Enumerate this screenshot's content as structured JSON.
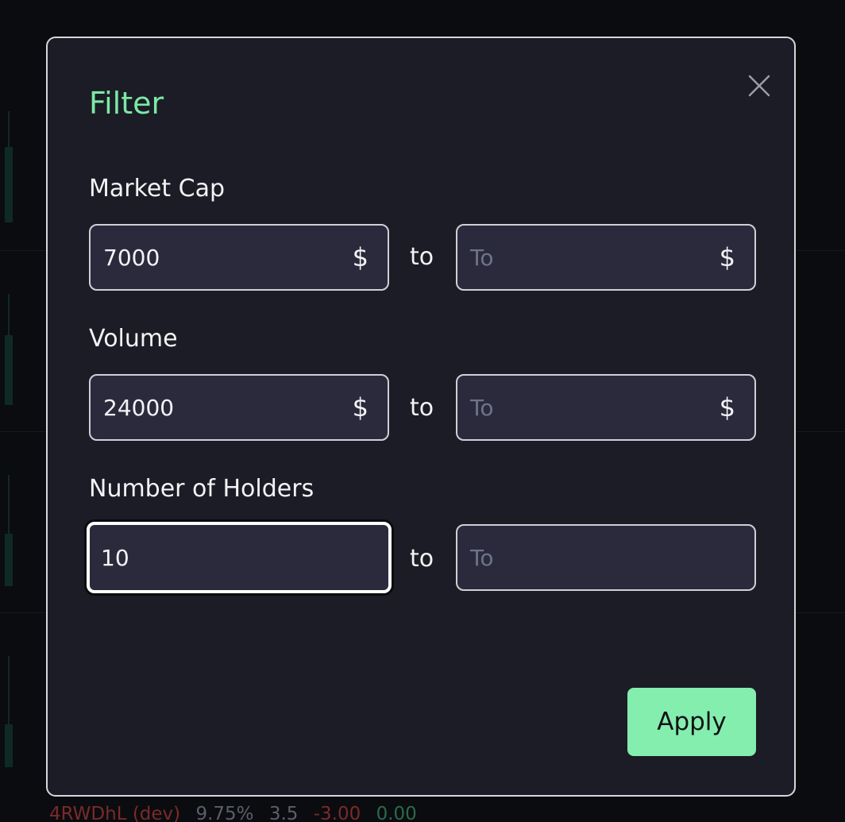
{
  "background": {
    "row_cells": [
      "4RWDhL (dev)",
      "9.75%",
      "3.5",
      "-3.00",
      "0.00"
    ]
  },
  "modal": {
    "title": "Filter",
    "close_icon": "close-icon",
    "apply_label": "Apply",
    "filters": [
      {
        "label": "Market Cap",
        "from_value": "7000",
        "from_unit": "$",
        "separator": "to",
        "to_value": "",
        "to_placeholder": "To",
        "to_unit": "$"
      },
      {
        "label": "Volume",
        "from_value": "24000",
        "from_unit": "$",
        "separator": "to",
        "to_value": "",
        "to_placeholder": "To",
        "to_unit": "$"
      },
      {
        "label": "Number of Holders",
        "from_value": "10",
        "separator": "to",
        "to_value": "",
        "to_placeholder": "To"
      }
    ]
  },
  "colors": {
    "accent": "#7ce8a6",
    "apply_button": "#84eeae",
    "modal_background": "#1b1c25",
    "input_background": "#2b2a3d"
  }
}
